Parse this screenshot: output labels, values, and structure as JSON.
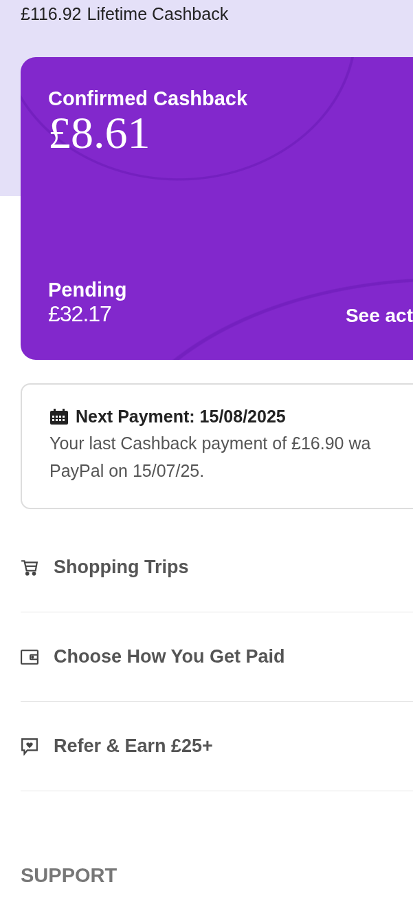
{
  "lifetime": {
    "amount": "£116.92",
    "label": "Lifetime Cashback"
  },
  "cashback_card": {
    "confirmed_label": "Confirmed Cashback",
    "confirmed_amount": "£8.61",
    "pending_label": "Pending",
    "pending_amount": "£32.17",
    "link": "See act"
  },
  "payment": {
    "title": "Next Payment: 15/08/2025",
    "message": "Your last Cashback payment of £16.90 wa\nPayPal on 15/07/25."
  },
  "menu": [
    {
      "kind": "cart",
      "label": "Shopping Trips"
    },
    {
      "kind": "wallet",
      "label": "Choose How You Get Paid"
    },
    {
      "kind": "chat-heart",
      "label": "Refer & Earn £25+"
    }
  ],
  "section_heading": "SUPPORT"
}
